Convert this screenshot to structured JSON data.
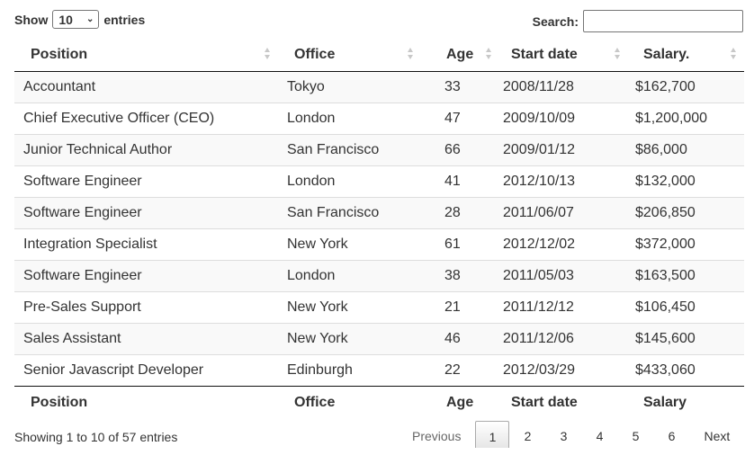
{
  "length": {
    "show_label": "Show",
    "selected": "10",
    "entries_label": "entries"
  },
  "search": {
    "label": "Search:",
    "value": ""
  },
  "columns": [
    "Position",
    "Office",
    "Age",
    "Start date",
    "Salary."
  ],
  "footer_columns": [
    "Position",
    "Office",
    "Age",
    "Start date",
    "Salary"
  ],
  "rows": [
    [
      "Accountant",
      "Tokyo",
      "33",
      "2008/11/28",
      "$162,700"
    ],
    [
      "Chief Executive Officer (CEO)",
      "London",
      "47",
      "2009/10/09",
      "$1,200,000"
    ],
    [
      "Junior Technical Author",
      "San Francisco",
      "66",
      "2009/01/12",
      "$86,000"
    ],
    [
      "Software Engineer",
      "London",
      "41",
      "2012/10/13",
      "$132,000"
    ],
    [
      "Software Engineer",
      "San Francisco",
      "28",
      "2011/06/07",
      "$206,850"
    ],
    [
      "Integration Specialist",
      "New York",
      "61",
      "2012/12/02",
      "$372,000"
    ],
    [
      "Software Engineer",
      "London",
      "38",
      "2011/05/03",
      "$163,500"
    ],
    [
      "Pre-Sales Support",
      "New York",
      "21",
      "2011/12/12",
      "$106,450"
    ],
    [
      "Sales Assistant",
      "New York",
      "46",
      "2011/12/06",
      "$145,600"
    ],
    [
      "Senior Javascript Developer",
      "Edinburgh",
      "22",
      "2012/03/29",
      "$433,060"
    ]
  ],
  "info": "Showing 1 to 10 of 57 entries",
  "pagination": {
    "previous": "Previous",
    "pages": [
      "1",
      "2",
      "3",
      "4",
      "5",
      "6"
    ],
    "current": "1",
    "next": "Next"
  }
}
